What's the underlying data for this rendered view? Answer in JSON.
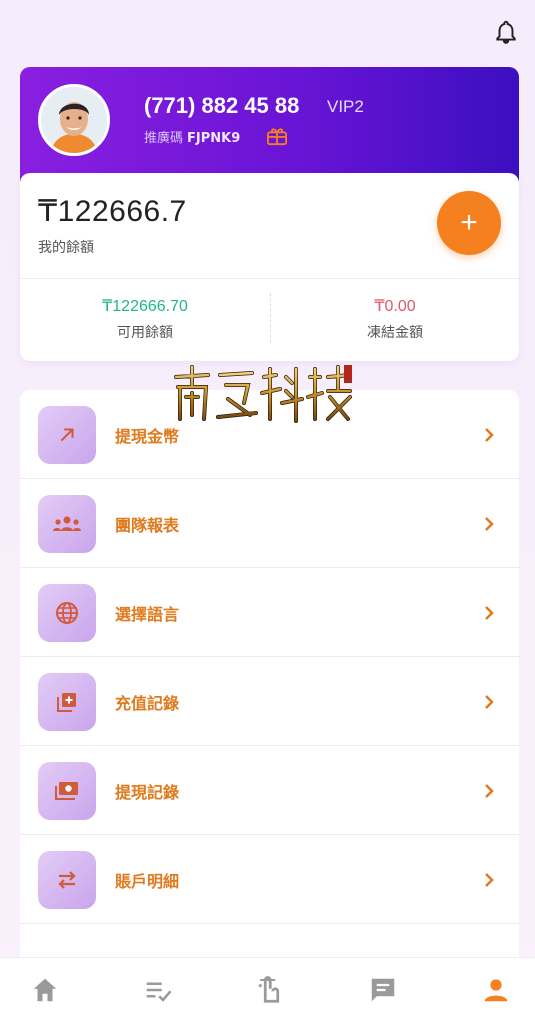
{
  "header": {
    "bell_icon": "bell-icon"
  },
  "profile": {
    "phone": "(771) 882 45 88",
    "vip": "VIP2",
    "promo_label": "推廣碼",
    "promo_code": "FJPNK9",
    "gift_icon": "gift-icon"
  },
  "balance": {
    "amount": "₸122666.7",
    "label": "我的餘額",
    "available_value": "₸122666.70",
    "available_label": "可用餘額",
    "frozen_value": "₸0.00",
    "frozen_label": "凍結金額",
    "available_color": "#22b683",
    "frozen_color": "#e0566a"
  },
  "menu": {
    "items": [
      {
        "label": "提現金幣",
        "icon": "arrow-up-right-icon"
      },
      {
        "label": "團隊報表",
        "icon": "team-icon"
      },
      {
        "label": "選擇語言",
        "icon": "globe-icon"
      },
      {
        "label": "充值記錄",
        "icon": "add-box-icon"
      },
      {
        "label": "提現記錄",
        "icon": "cash-icon"
      },
      {
        "label": "賬戶明細",
        "icon": "swap-icon"
      }
    ]
  },
  "colors": {
    "accent": "#f5801f",
    "primary_gradient": [
      "#8a1fe0",
      "#3c0fc0"
    ]
  }
}
